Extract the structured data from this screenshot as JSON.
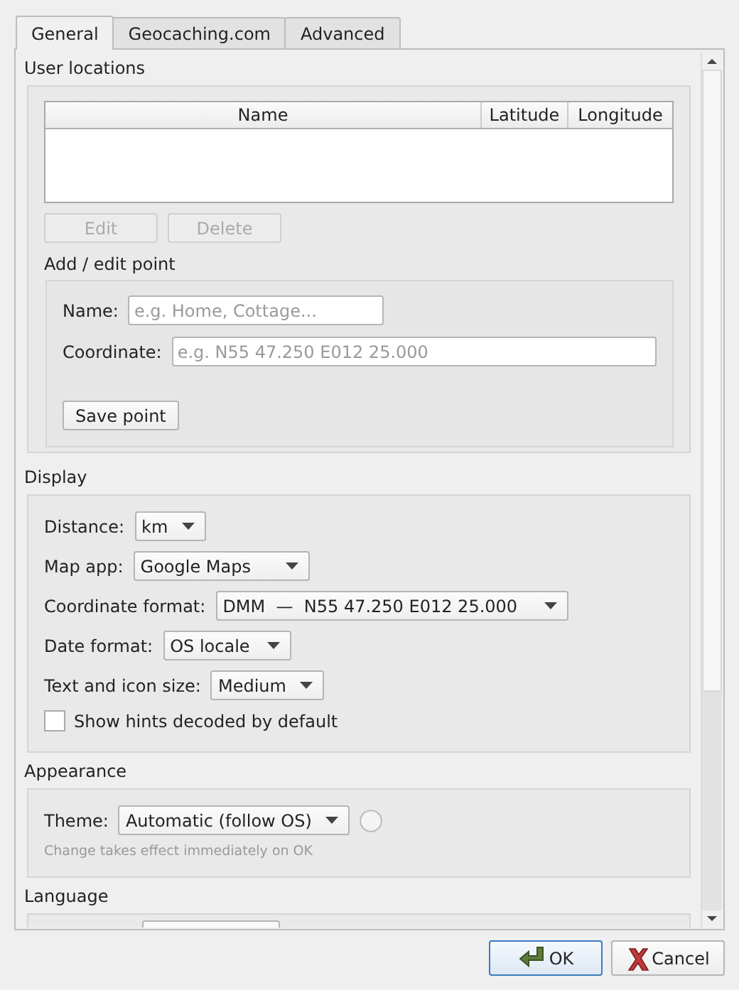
{
  "tabs": [
    {
      "label": "General",
      "selected": true
    },
    {
      "label": "Geocaching.com",
      "selected": false
    },
    {
      "label": "Advanced",
      "selected": false
    }
  ],
  "user_locations": {
    "title": "User locations",
    "table": {
      "columns": [
        "Name",
        "Latitude",
        "Longitude"
      ]
    },
    "buttons": [
      {
        "label": "Edit",
        "disabled": true
      },
      {
        "label": "Delete",
        "disabled": true
      }
    ],
    "add_edit_point": {
      "title": "Add / edit point",
      "fields": [
        {
          "label": "Name:",
          "placeholder": "e.g. Home, Cottage...",
          "wide": false
        },
        {
          "label": "Coordinate:",
          "placeholder": "e.g. N55 47.250 E012 25.000",
          "wide": true
        }
      ],
      "save_button": "Save point"
    }
  },
  "display": {
    "title": "Display",
    "rows": [
      {
        "kind": "dropdown",
        "label": "Distance:",
        "value": "km"
      },
      {
        "kind": "dropdown",
        "label": "Map app:",
        "value": "Google Maps"
      },
      {
        "kind": "dropdown",
        "label": "Coordinate format:",
        "value": "DMM  —  N55 47.250 E012 25.000"
      },
      {
        "kind": "dropdown",
        "label": "Date format:",
        "value": "OS locale"
      },
      {
        "kind": "dropdown",
        "label": "Text and icon size:",
        "value": "Medium"
      },
      {
        "kind": "checkbox",
        "label": "Show hints decoded by default",
        "checked": false
      }
    ]
  },
  "appearance": {
    "title": "Appearance",
    "theme_label": "Theme:",
    "theme_value": "Automatic (follow OS)",
    "hint": "Change takes effect immediately on OK"
  },
  "language": {
    "title": "Language"
  },
  "buttons": [
    {
      "kind": "ok",
      "label": "OK"
    },
    {
      "kind": "cancel",
      "label": "Cancel"
    }
  ]
}
